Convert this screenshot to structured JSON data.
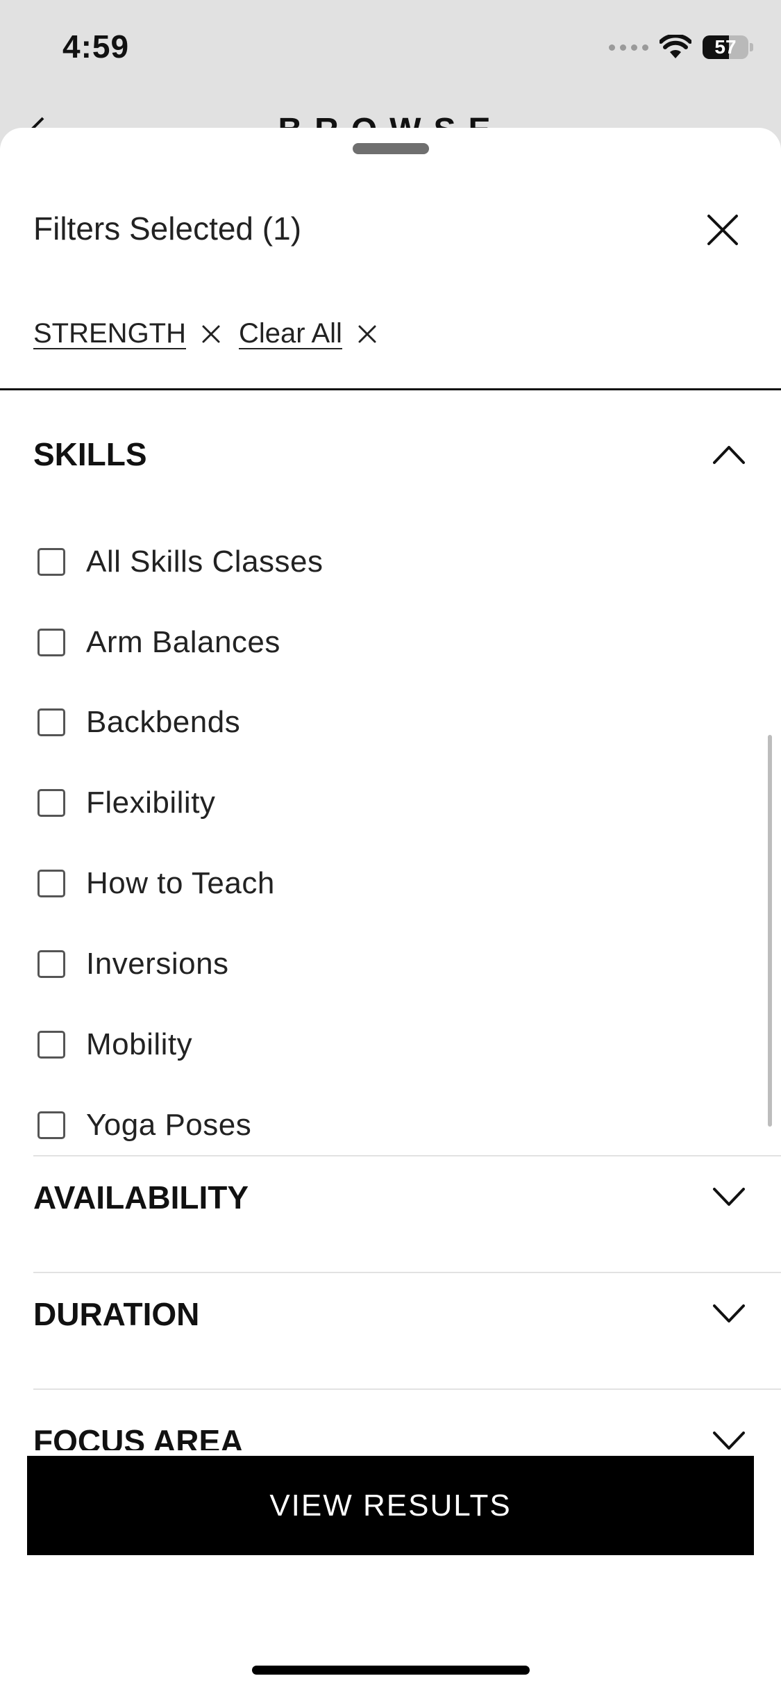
{
  "status_bar": {
    "time": "4:59",
    "battery_level": "57",
    "battery_fraction": 0.57
  },
  "background_page": {
    "title": "BROWSE"
  },
  "sheet": {
    "title": "Filters Selected (1)",
    "chips": [
      {
        "label": "STRENGTH"
      },
      {
        "label": "Clear All"
      }
    ],
    "skills_section": {
      "title": "SKILLS",
      "expanded": true,
      "options": [
        {
          "label": "All Skills Classes",
          "checked": false
        },
        {
          "label": "Arm Balances",
          "checked": false
        },
        {
          "label": "Backbends",
          "checked": false
        },
        {
          "label": "Flexibility",
          "checked": false
        },
        {
          "label": "How to Teach",
          "checked": false
        },
        {
          "label": "Inversions",
          "checked": false
        },
        {
          "label": "Mobility",
          "checked": false
        },
        {
          "label": "Yoga Poses",
          "checked": false
        }
      ]
    },
    "collapsed_sections": [
      {
        "title": "AVAILABILITY"
      },
      {
        "title": "DURATION"
      },
      {
        "title": "FOCUS AREA"
      }
    ],
    "view_results_label": "VIEW RESULTS"
  },
  "icons": {
    "close": "close-icon",
    "chip_remove": "close-icon",
    "expanded": "chevron-up-icon",
    "collapsed": "chevron-down-icon",
    "wifi": "wifi-icon",
    "back": "chevron-left-icon"
  },
  "colors": {
    "primary_button": "#000000",
    "sheet_background": "#ffffff",
    "backdrop": "#e1e1e1"
  }
}
